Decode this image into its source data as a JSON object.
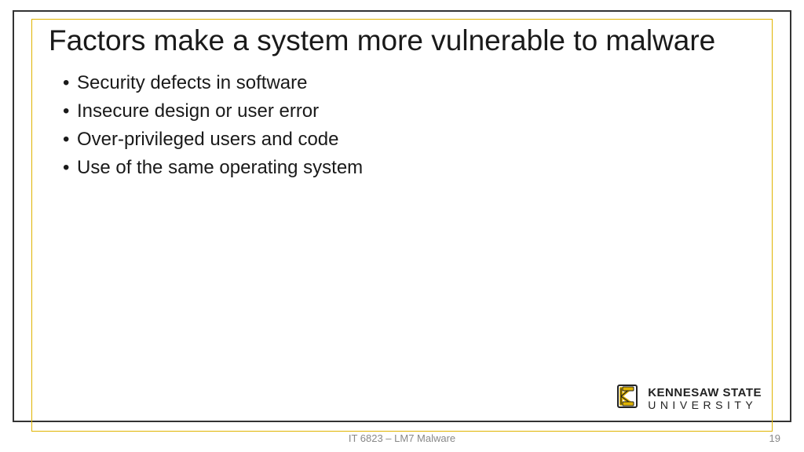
{
  "slide": {
    "title": "Factors make a system more vulnerable to malware",
    "bullets": [
      "Security defects in software",
      "Insecure design or user error",
      "Over-privileged users and code",
      "Use of the same operating system"
    ]
  },
  "logo": {
    "line1": "KENNESAW STATE",
    "line2": "UNIVERSITY"
  },
  "footer": {
    "text": "IT 6823 – LM7 Malware",
    "page": "19"
  }
}
